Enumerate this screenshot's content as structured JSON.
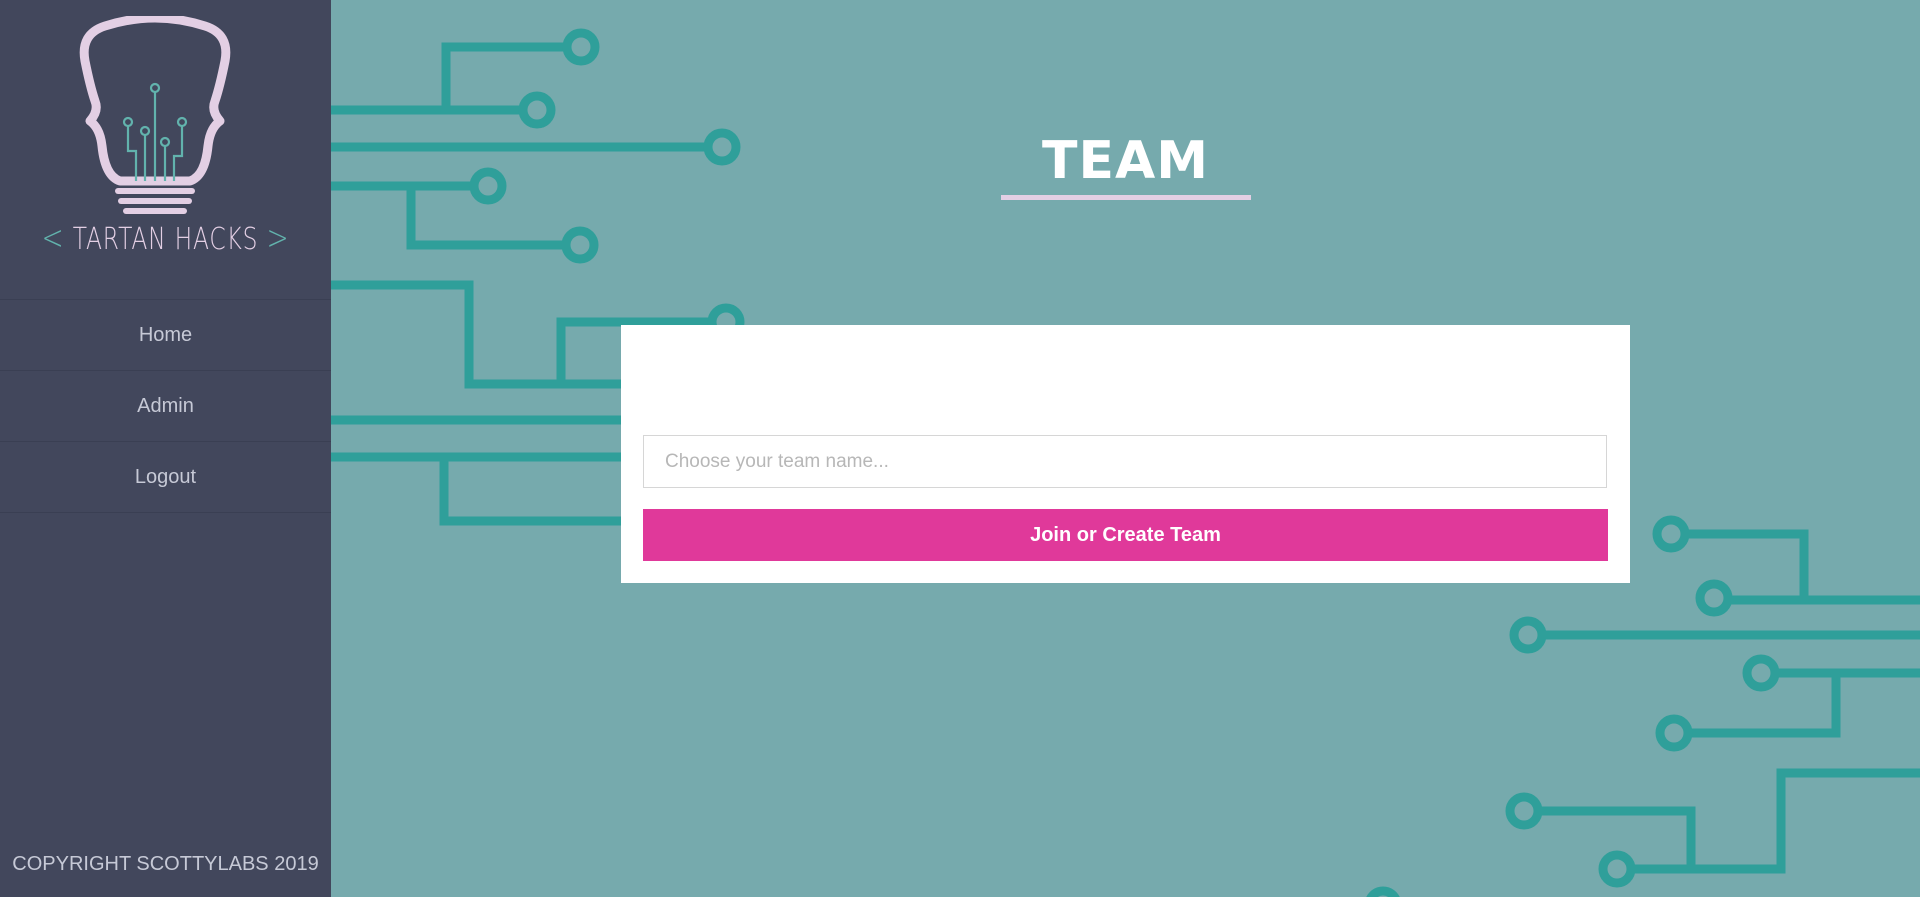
{
  "sidebar": {
    "brand": {
      "open": "<",
      "name": "TARTAN HACKS",
      "close": ">"
    },
    "nav": [
      {
        "label": "Home"
      },
      {
        "label": "Admin"
      },
      {
        "label": "Logout"
      }
    ],
    "copyright": "COPYRIGHT SCOTTYLABS 2019"
  },
  "main": {
    "title": "TEAM",
    "form": {
      "team_name_placeholder": "Choose your team name...",
      "team_name_value": "",
      "submit_label": "Join or Create Team"
    }
  },
  "colors": {
    "sidebar_bg": "#42475c",
    "page_bg": "#76aaad",
    "circuit": "#2f9f9a",
    "accent_pink": "#e0399a",
    "logo_pink": "#e3cfe4"
  },
  "icons": [
    "lightbulb-logo-icon"
  ]
}
